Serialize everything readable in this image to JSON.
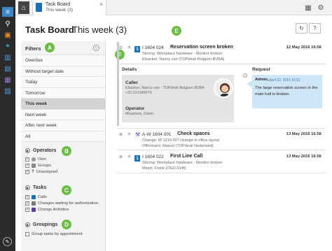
{
  "tab": {
    "line1": "Task Board",
    "line2": "This week (3)"
  },
  "page": {
    "title": "Task Board",
    "subtitle": "This week (3)"
  },
  "filters": {
    "title": "Filters",
    "items": [
      "Overdue",
      "Without target date",
      "Today",
      "Tomorrow",
      "This week",
      "Next week",
      "After next week",
      "All"
    ],
    "active_index": 4,
    "operators": {
      "title": "Operators",
      "options": [
        {
          "label": "Own",
          "checked": true
        },
        {
          "label": "Groups",
          "checked": true
        },
        {
          "label": "Unassigned",
          "checked": true
        }
      ]
    },
    "tasks": {
      "title": "Tasks",
      "options": [
        {
          "label": "Calls",
          "checked": true
        },
        {
          "label": "Changes waiting for authorization",
          "checked": true
        },
        {
          "label": "Change Activities",
          "checked": true
        }
      ]
    },
    "groupings": {
      "title": "Groupings",
      "options": [
        {
          "label": "Group tasks by appointment",
          "checked": false
        }
      ]
    }
  },
  "badges": [
    "A",
    "B",
    "C",
    "D",
    "E",
    "F"
  ],
  "tasks": [
    {
      "priority": "1",
      "number": "I 1604 024",
      "subject": "Reservation screen broken",
      "date": "12 May 2016 16:56",
      "line2": "Storing: Workplace hardware - Monitor broken",
      "line3": "Elsacker, Nancy van (TOPdesk Belgium BVBA)"
    },
    {
      "priority": "",
      "number": "A-W 1604 001",
      "subject": "Check spaces",
      "date": "13 May 2016 16:56",
      "line2": "Change: W 1210 007 change in office layout",
      "line3": "Offermans, Marcel (TOPdesk Nederland)"
    },
    {
      "priority": "1",
      "number": "I 1604 022",
      "subject": "First Line Call",
      "date": "13 May 2016 16:56",
      "line2": "Storing: Workplace hardware - Monitor broken",
      "line3": "Meert, Frank (OGD Delft)"
    }
  ],
  "details": {
    "details_label": "Details",
    "request_label": "Request",
    "caller_label": "Caller",
    "caller_name": "Elsacker, Nancy van - TOPdesk Belgium BVBA",
    "caller_phone": "+32 012345679",
    "operator_label": "Operator",
    "operator_name": "Meadows, Dawn",
    "request_author": "Admin,",
    "request_time": "April 22, 2016 16:51",
    "request_text": "The large reservation screen in the main hall is broken."
  },
  "colors": {
    "badge": "#6cbd45",
    "priority": "#1a70b8",
    "request_bg": "#cfe6f7",
    "rail": "#2b2b2b"
  }
}
